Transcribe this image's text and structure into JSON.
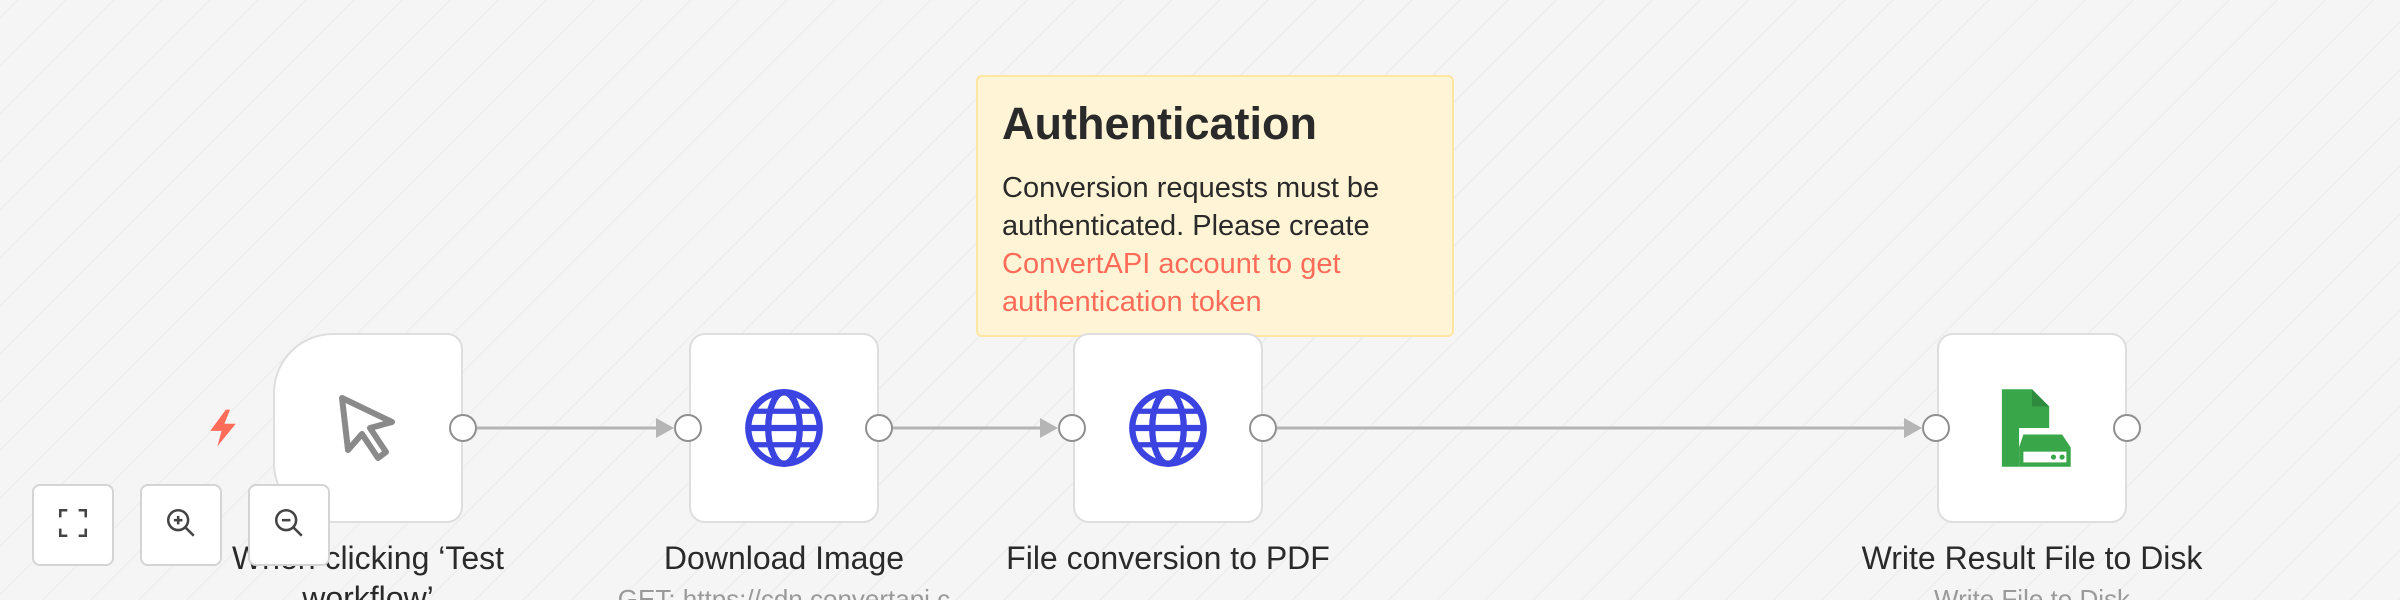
{
  "canvas": {
    "background": "#f5f5f5"
  },
  "sticky_note": {
    "title": "Authentication",
    "body_text": "Conversion requests must be authenticated. Please create ",
    "link_text": "ConvertAPI account to get authentication token",
    "background_color": "#fff5d6",
    "link_color": "#ff6d5a"
  },
  "nodes": [
    {
      "id": "trigger",
      "label": "When clicking ‘Test workflow’",
      "subtitle": "",
      "icon": "cursor-pointer-icon",
      "icon_color": "#8a8a8a"
    },
    {
      "id": "download-image",
      "label": "Download Image",
      "subtitle": "GET: https://cdn.convertapi.c",
      "icon": "globe-icon",
      "icon_color": "#3b43e0"
    },
    {
      "id": "file-conversion",
      "label": "File conversion to PDF",
      "subtitle": "",
      "icon": "globe-icon",
      "icon_color": "#3b43e0"
    },
    {
      "id": "write-file",
      "label": "Write Result File to Disk",
      "subtitle": "Write File to Disk",
      "icon": "file-disk-icon",
      "icon_color": "#3aa64a"
    }
  ],
  "trigger_marker": {
    "icon": "lightning-bolt-icon",
    "color": "#ff6d5a"
  },
  "zoom_controls": [
    {
      "id": "fit-view",
      "icon": "fit-to-view-icon"
    },
    {
      "id": "zoom-in",
      "icon": "zoom-in-icon"
    },
    {
      "id": "zoom-out",
      "icon": "zoom-out-icon"
    }
  ]
}
